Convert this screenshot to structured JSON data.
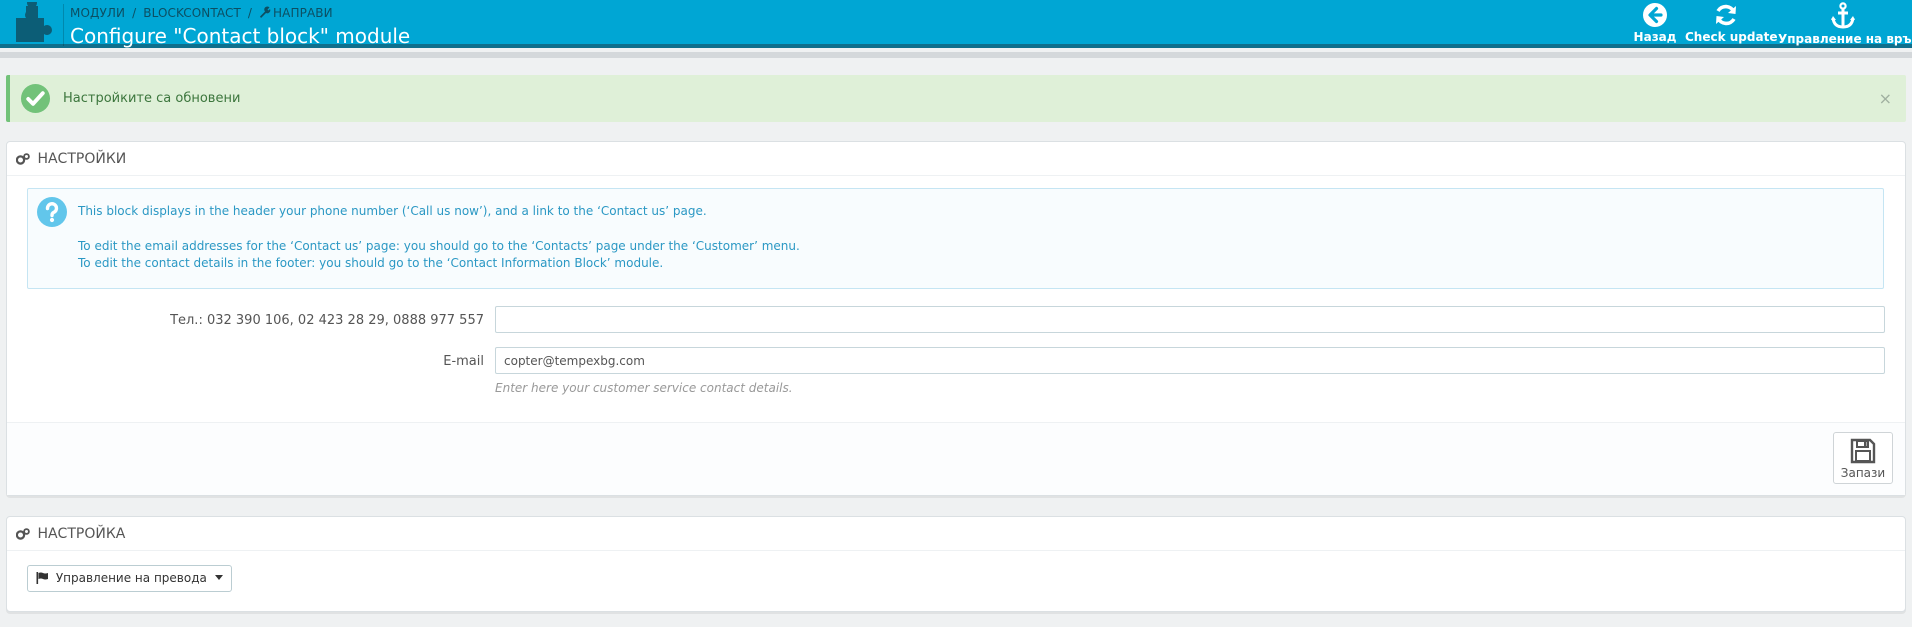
{
  "header": {
    "breadcrumb": [
      "Модули",
      "blockcontact",
      "Направи"
    ],
    "title": "Configure \"Contact block\" module",
    "buttons": [
      {
        "label": "Назад",
        "icon": "arrow-left-circle-icon"
      },
      {
        "label": "Check update",
        "icon": "refresh-icon"
      },
      {
        "label": "Управление на връзки",
        "icon": "anchor-icon"
      }
    ]
  },
  "alert": {
    "message": "Настройките са обновени",
    "close": "×",
    "color": "#dff0d8"
  },
  "settings_panel": {
    "heading": "Настройки",
    "info": {
      "line1": "This block displays in the header your phone number (‘Call us now’), and a link to the ‘Contact us’ page.",
      "line2": "To edit the email addresses for the ‘Contact us’ page: you should go to the ‘Contacts’ page under the ‘Customer’ menu.",
      "line3": "To edit the contact details in the footer: you should go to the ‘Contact Information Block’ module."
    },
    "fields": {
      "phone_label": "Тел.: 032 390 106, 02 423 28 29, 0888 977 557",
      "phone_value": "",
      "email_label": "E-mail",
      "email_value": "copter@tempexbg.com",
      "help": "Enter here your customer service contact details."
    },
    "save_label": "Запази"
  },
  "config_panel": {
    "heading": "Настройка",
    "translate_button": "Управление на превода"
  },
  "colors": {
    "header": "#00a6d4",
    "accent_info": "#2b98c4",
    "success": "#72c279"
  }
}
